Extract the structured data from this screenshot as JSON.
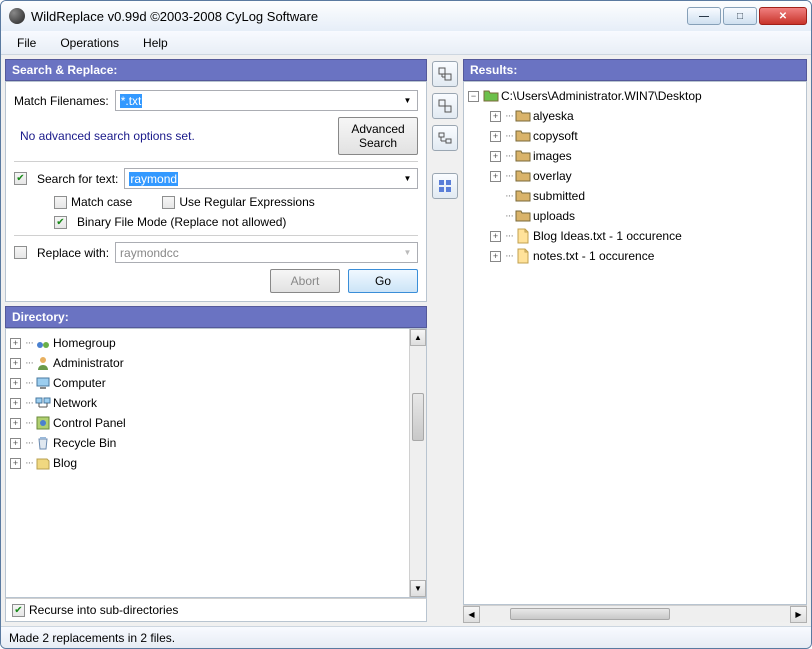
{
  "window": {
    "title": "WildReplace v0.99d ©2003-2008 CyLog Software"
  },
  "menu": {
    "file": "File",
    "operations": "Operations",
    "help": "Help"
  },
  "search_panel": {
    "title": "Search & Replace:",
    "match_filenames_label": "Match Filenames:",
    "match_filenames_value": "*.txt",
    "advanced_msg": "No advanced search options set.",
    "advanced_btn": "Advanced\nSearch",
    "search_for_text_label": "Search for text:",
    "search_for_text_value": "raymond",
    "match_case_label": "Match case",
    "use_regex_label": "Use Regular Expressions",
    "binary_mode_label": "Binary File Mode (Replace not allowed)",
    "replace_with_label": "Replace with:",
    "replace_with_value": "raymondcc",
    "abort_btn": "Abort",
    "go_btn": "Go",
    "search_checked": true,
    "match_case_checked": false,
    "regex_checked": false,
    "binary_checked": true,
    "replace_checked": false
  },
  "directory_panel": {
    "title": "Directory:",
    "items": [
      {
        "label": "Homegroup"
      },
      {
        "label": "Administrator"
      },
      {
        "label": "Computer"
      },
      {
        "label": "Network"
      },
      {
        "label": "Control Panel"
      },
      {
        "label": "Recycle Bin"
      },
      {
        "label": "Blog"
      }
    ],
    "recurse_label": "Recurse into sub-directories",
    "recurse_checked": true
  },
  "results_panel": {
    "title": "Results:",
    "root": "C:\\Users\\Administrator.WIN7\\Desktop",
    "children": [
      {
        "type": "folder",
        "label": "alyeska",
        "exp": true
      },
      {
        "type": "folder",
        "label": "copysoft",
        "exp": true
      },
      {
        "type": "folder",
        "label": "images",
        "exp": true
      },
      {
        "type": "folder",
        "label": "overlay",
        "exp": true
      },
      {
        "type": "folder",
        "label": "submitted",
        "exp": false
      },
      {
        "type": "folder",
        "label": "uploads",
        "exp": false
      },
      {
        "type": "file",
        "label": "Blog Ideas.txt - 1 occurence",
        "exp": true
      },
      {
        "type": "file",
        "label": "notes.txt - 1 occurence",
        "exp": true
      }
    ]
  },
  "statusbar": {
    "text": "Made 2 replacements in 2 files."
  }
}
